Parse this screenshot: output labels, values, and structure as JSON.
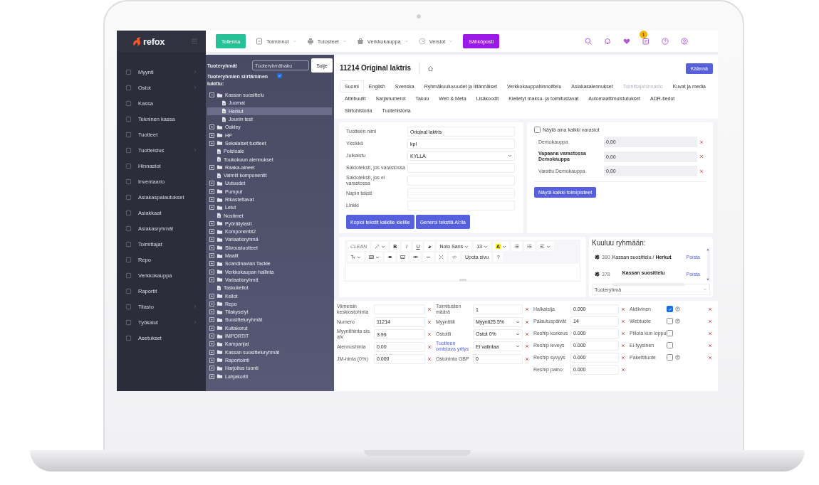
{
  "app": {
    "logo": "refox"
  },
  "sidebar": {
    "items": [
      {
        "label": "Myynti",
        "submenu": true
      },
      {
        "label": "Ostot",
        "submenu": true
      },
      {
        "label": "Kassa",
        "submenu": false
      },
      {
        "label": "Tekninen kassa",
        "submenu": false
      },
      {
        "label": "Tuotteet",
        "submenu": false
      },
      {
        "label": "Tuotteistus",
        "submenu": true
      },
      {
        "label": "Hinnastot",
        "submenu": false
      },
      {
        "label": "Inventaario",
        "submenu": false
      },
      {
        "label": "Asiakaspalautukset",
        "submenu": false
      },
      {
        "label": "Asiakkaat",
        "submenu": false
      },
      {
        "label": "Asiakasryhmät",
        "submenu": false
      },
      {
        "label": "Toimittajat",
        "submenu": false
      },
      {
        "label": "Repo",
        "submenu": false
      },
      {
        "label": "Verkkokauppa",
        "submenu": false
      },
      {
        "label": "Raportit",
        "submenu": false
      },
      {
        "label": "Tilasto",
        "submenu": true
      },
      {
        "label": "Työkalut",
        "submenu": true
      },
      {
        "label": "Asetukset",
        "submenu": false
      }
    ]
  },
  "toolbar": {
    "save_button": "Tallenna",
    "menus": [
      "Toiminnot",
      "Tulosteet",
      "Verkkokauppa",
      "Versiot"
    ],
    "email_button": "Sähköposti",
    "notification_badge": "1"
  },
  "group_panel": {
    "title": "Tuoteryhmät",
    "search": {
      "placeholder": "Tuoteryhmähaku"
    },
    "close_button": "Sulje",
    "lock_label": "Tuoteryhmien siirtäminen lukittu:",
    "lock_checked": true,
    "tree": [
      {
        "label": "Kassan suosittelu",
        "kind": "folder",
        "expanded": true,
        "selected": false,
        "children": [
          {
            "label": "Juomat",
            "kind": "file",
            "selected": false
          },
          {
            "label": "Herkut",
            "kind": "file",
            "selected": true
          },
          {
            "label": "Jounin test",
            "kind": "file",
            "selected": false
          }
        ]
      },
      {
        "label": "Oakley",
        "kind": "folder",
        "expanded": false,
        "selected": false
      },
      {
        "label": "HP",
        "kind": "folder",
        "expanded": false,
        "selected": false
      },
      {
        "label": "Sekalaiset tuotteet",
        "kind": "folder",
        "expanded": false,
        "selected": false
      },
      {
        "label": "Poistoale",
        "kind": "file",
        "selected": false
      },
      {
        "label": "Toukokuun alennukset",
        "kind": "file",
        "selected": false
      },
      {
        "label": "Raaka-aineet",
        "kind": "folder",
        "expanded": false,
        "selected": false
      },
      {
        "label": "Valmiit komponentit",
        "kind": "file",
        "selected": false
      },
      {
        "label": "Uutuudet",
        "kind": "folder",
        "expanded": false,
        "selected": false
      },
      {
        "label": "Pumput",
        "kind": "folder",
        "expanded": false,
        "selected": false
      },
      {
        "label": "Rikastettavat",
        "kind": "folder",
        "expanded": false,
        "selected": false
      },
      {
        "label": "Lelut",
        "kind": "folder",
        "expanded": false,
        "selected": false
      },
      {
        "label": "Nostimet",
        "kind": "file",
        "selected": false
      },
      {
        "label": "Pyöräilylasit",
        "kind": "folder",
        "expanded": false,
        "selected": false
      },
      {
        "label": "Komponentit2",
        "kind": "folder",
        "expanded": false,
        "selected": false
      },
      {
        "label": "Variaatioryhmä",
        "kind": "folder",
        "expanded": false,
        "selected": false
      },
      {
        "label": "Siivoustuotteet",
        "kind": "folder",
        "expanded": false,
        "selected": false
      },
      {
        "label": "Maalit",
        "kind": "folder",
        "expanded": false,
        "selected": false
      },
      {
        "label": "Scandinavian Tackle",
        "kind": "folder",
        "expanded": false,
        "selected": false
      },
      {
        "label": "Verkkokaupan hallinta",
        "kind": "folder",
        "expanded": false,
        "selected": false
      },
      {
        "label": "Variaatioryhmä",
        "kind": "folder",
        "expanded": false,
        "selected": false
      },
      {
        "label": "Taskukellot",
        "kind": "file",
        "selected": false
      },
      {
        "label": "Kellot",
        "kind": "folder",
        "expanded": false,
        "selected": false
      },
      {
        "label": "Repo",
        "kind": "folder",
        "expanded": false,
        "selected": false
      },
      {
        "label": "Tilakyselyt",
        "kind": "folder",
        "expanded": false,
        "selected": false
      },
      {
        "label": "Suositteluryhmät",
        "kind": "folder",
        "expanded": false,
        "selected": false
      },
      {
        "label": "Kultakorut",
        "kind": "folder",
        "expanded": false,
        "selected": false
      },
      {
        "label": "IMPORTIT",
        "kind": "folder",
        "expanded": false,
        "selected": false
      },
      {
        "label": "Kampanjat",
        "kind": "folder",
        "expanded": false,
        "selected": false
      },
      {
        "label": "Kassan suositteluryhmät",
        "kind": "folder",
        "expanded": false,
        "selected": false
      },
      {
        "label": "Raportointi",
        "kind": "folder",
        "expanded": false,
        "selected": false
      },
      {
        "label": "Harjoitus tuonti",
        "kind": "folder",
        "expanded": false,
        "selected": false
      },
      {
        "label": "Lahjakortit",
        "kind": "folder",
        "expanded": false,
        "selected": false
      }
    ]
  },
  "product": {
    "title": "11214 Original laktris",
    "translate_button": "Käännä"
  },
  "tabs": [
    {
      "label": "Suomi",
      "selected": true,
      "disabled": false
    },
    {
      "label": "English",
      "selected": false,
      "disabled": false
    },
    {
      "label": "Svenska",
      "selected": false,
      "disabled": false
    },
    {
      "label": "Ryhmäkuuluvuudet ja liitännäiset",
      "selected": false,
      "disabled": false
    },
    {
      "label": "Verkkokauppahinnoittelu",
      "selected": false,
      "disabled": false
    },
    {
      "label": "Asiakasalennukset",
      "selected": false,
      "disabled": false
    },
    {
      "label": "Toimittajahinnasto",
      "selected": false,
      "disabled": true
    },
    {
      "label": "Kuvat ja media",
      "selected": false,
      "disabled": false
    },
    {
      "label": "Attribuutit",
      "selected": false,
      "disabled": false
    },
    {
      "label": "Sarjanumerot",
      "selected": false,
      "disabled": false
    },
    {
      "label": "Takuu",
      "selected": false,
      "disabled": false
    },
    {
      "label": "Web & Meta",
      "selected": false,
      "disabled": false
    },
    {
      "label": "Lisäkoodit",
      "selected": false,
      "disabled": false
    },
    {
      "label": "Kielletyt maksu- ja toimitustavat",
      "selected": false,
      "disabled": false
    },
    {
      "label": "Automaattimuistutukset",
      "selected": false,
      "disabled": false
    },
    {
      "label": "ADR-tiedot",
      "selected": false,
      "disabled": false
    },
    {
      "label": "Siirtohistoria",
      "selected": false,
      "disabled": false
    },
    {
      "label": "Tuotehistoria",
      "selected": false,
      "disabled": false
    }
  ],
  "text_form": {
    "fields": [
      {
        "label": "Tuotteen nimi",
        "value": "Original laktris",
        "kind": "input"
      },
      {
        "label": "Yksikkö",
        "value": "kpl",
        "kind": "input"
      },
      {
        "label": "Julkaistu",
        "value": "KYLLÄ",
        "kind": "select"
      },
      {
        "label": "Saldoteksti, jos varastossa",
        "kind": "input"
      },
      {
        "label": "Saldoteksti, jos ei varastossa",
        "kind": "input"
      },
      {
        "label": "Napin teksti",
        "kind": "input"
      },
      {
        "label": "Linkki",
        "kind": "input"
      }
    ],
    "buttons": [
      "Kopioi tekstit kaikille kielille",
      "Generoi tekstiä AI:lla"
    ]
  },
  "stock": {
    "show_all": {
      "label": "Näytä aina kaikki varastot",
      "checked": false
    },
    "rows": [
      {
        "label": "Demokauppa",
        "value": "0,00",
        "emphasized": false
      },
      {
        "label": "Vapaana varastossa Demokauppa",
        "value": "0,00",
        "emphasized": true
      },
      {
        "label": "Varattu Demokauppa",
        "value": "0,00",
        "emphasized": false
      }
    ],
    "button": "Näytä kaikki toimipisteet"
  },
  "editor": {
    "clean": "CLEAN",
    "bold": "B",
    "italic": "I",
    "underline": "U",
    "font": "Noto Sans",
    "size": "13",
    "highlight": "A",
    "embed": "Upota sivu",
    "help": "?"
  },
  "groups": {
    "title": "Kuuluu ryhmään:",
    "items": [
      {
        "id": "380",
        "label": "Kassan suosittelu / **Herkut**",
        "top_level": false,
        "action": "Poista"
      },
      {
        "id": "378",
        "label": "Kassan suosittelu",
        "top_level": true,
        "action": "Poista"
      }
    ],
    "select": {
      "placeholder": "Tuoteryhmä"
    }
  },
  "details": {
    "column_1": [
      {
        "label": "Viimeisin keskiostohinta",
        "kind": "input"
      },
      {
        "label": "Numero",
        "value": "11214",
        "kind": "input"
      },
      {
        "label": "Myyntihinta sis. alv",
        "value": "3.99",
        "kind": "input"
      },
      {
        "label": "Alennushinta",
        "value": "0.00",
        "kind": "input"
      },
      {
        "label": "JM-hinta (0%)",
        "value": "0.000",
        "kind": "input"
      }
    ],
    "column_2": [
      {
        "label": "Toimitusten määrä",
        "value": "1",
        "kind": "input",
        "linked": false
      },
      {
        "label": "Myyntitili",
        "value": "Myynti25.5%",
        "kind": "select",
        "linked": false
      },
      {
        "label": "Ostotili",
        "value": "Ostot 0%",
        "kind": "select",
        "linked": false
      },
      {
        "label": "Tuotteen omistava yritys",
        "value": "Ei valintaa",
        "kind": "select",
        "linked": true
      },
      {
        "label": "Ostohinta GBP",
        "value": "0",
        "kind": "input",
        "linked": false
      }
    ],
    "column_3": [
      {
        "label": "Halkaisija",
        "value": "0.000",
        "kind": "input"
      },
      {
        "label": "Palautuspäivät",
        "value": "14",
        "kind": "input"
      },
      {
        "label": "Reship korkeus",
        "value": "0.000",
        "kind": "input"
      },
      {
        "label": "Reship leveys",
        "value": "0.000",
        "kind": "input"
      },
      {
        "label": "Reship syvyys",
        "value": "0.000",
        "kind": "input"
      },
      {
        "label": "Reship paino",
        "value": "0.000",
        "kind": "input"
      }
    ],
    "column_4": [
      {
        "label": "Aktiivinen",
        "checked": true,
        "help": true
      },
      {
        "label": "Webtuote",
        "checked": false,
        "help": true
      },
      {
        "label": "Piilota kun loppu",
        "checked": false,
        "help": false
      },
      {
        "label": "Ei-fyysinen",
        "checked": false,
        "help": false
      },
      {
        "label": "Pakettituote",
        "checked": false,
        "help": true
      }
    ]
  }
}
